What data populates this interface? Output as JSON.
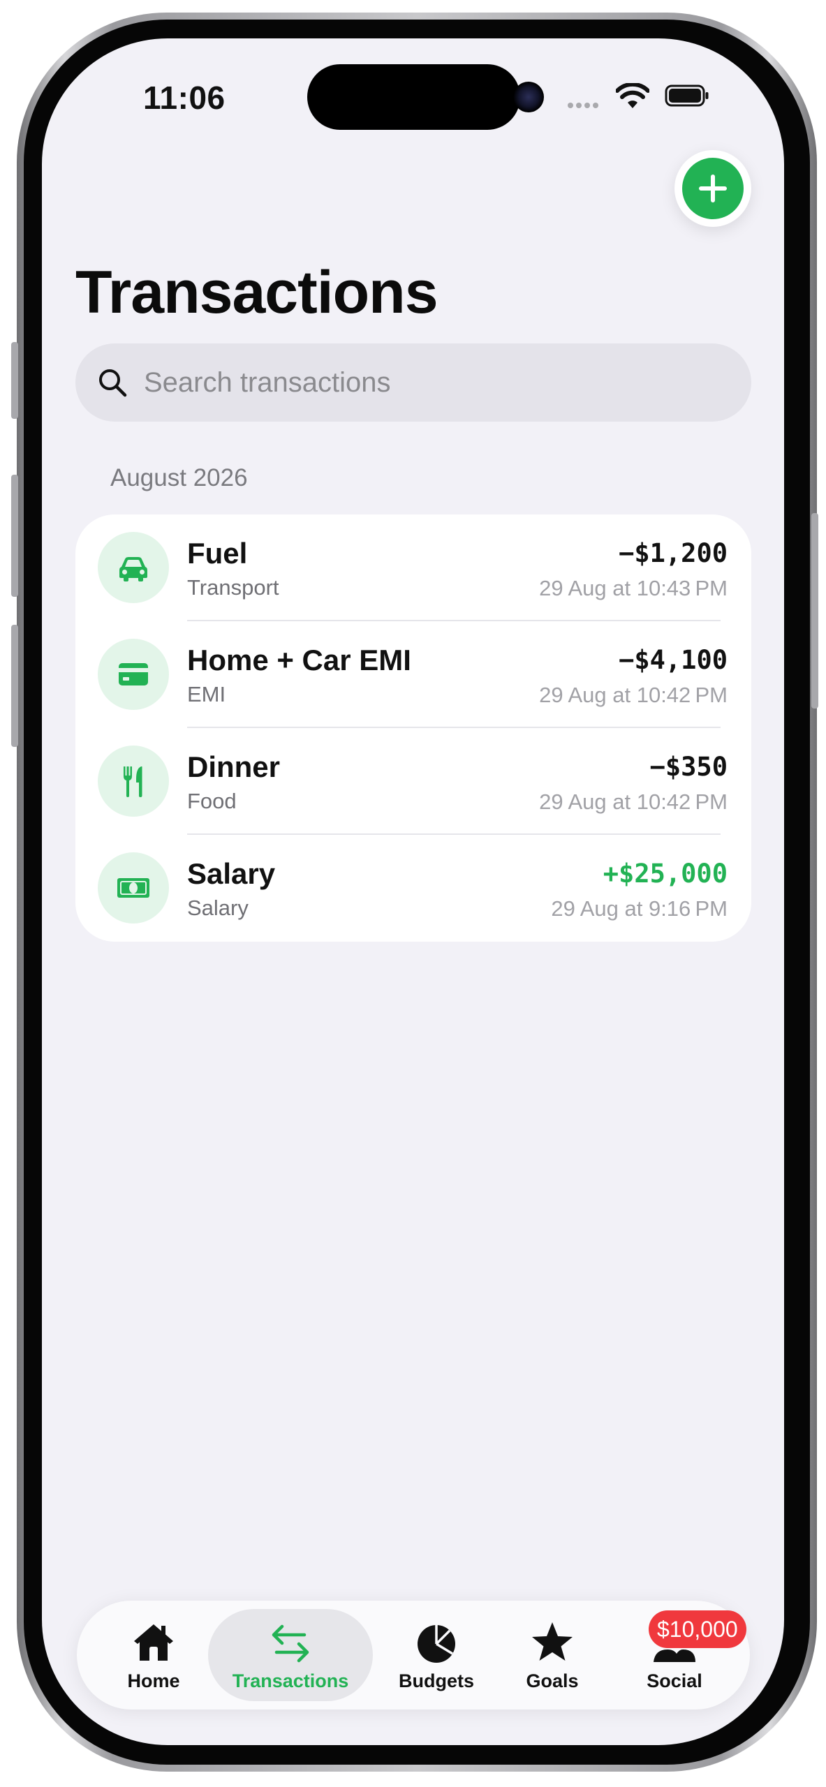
{
  "status_bar": {
    "time": "11:06"
  },
  "header": {
    "title": "Transactions",
    "add_icon": "plus-icon"
  },
  "search": {
    "placeholder": "Search transactions",
    "value": ""
  },
  "section": {
    "label": "August 2026"
  },
  "transactions": [
    {
      "name": "Fuel",
      "category": "Transport",
      "amount": "−$1,200",
      "when": "29 Aug at 10:43 PM",
      "icon": "car-icon",
      "positive": false
    },
    {
      "name": "Home + Car EMI",
      "category": "EMI",
      "amount": "−$4,100",
      "when": "29 Aug at 10:42 PM",
      "icon": "credit-card-icon",
      "positive": false
    },
    {
      "name": "Dinner",
      "category": "Food",
      "amount": "−$350",
      "when": "29 Aug at 10:42 PM",
      "icon": "fork-knife-icon",
      "positive": false
    },
    {
      "name": "Salary",
      "category": "Salary",
      "amount": "+$25,000",
      "when": "29 Aug at 9:16 PM",
      "icon": "banknote-icon",
      "positive": true
    }
  ],
  "tabs": [
    {
      "label": "Home",
      "icon": "house-icon",
      "active": false
    },
    {
      "label": "Transactions",
      "icon": "arrows-swap-icon",
      "active": true
    },
    {
      "label": "Budgets",
      "icon": "pie-chart-icon",
      "active": false
    },
    {
      "label": "Goals",
      "icon": "star-icon",
      "active": false
    },
    {
      "label": "Social",
      "icon": "people-icon",
      "active": false,
      "badge": "$10,000"
    }
  ],
  "colors": {
    "accent": "#22b254",
    "icon_bg": "#e3f5e9",
    "badge": "#f0383d",
    "background": "#f2f1f7"
  }
}
